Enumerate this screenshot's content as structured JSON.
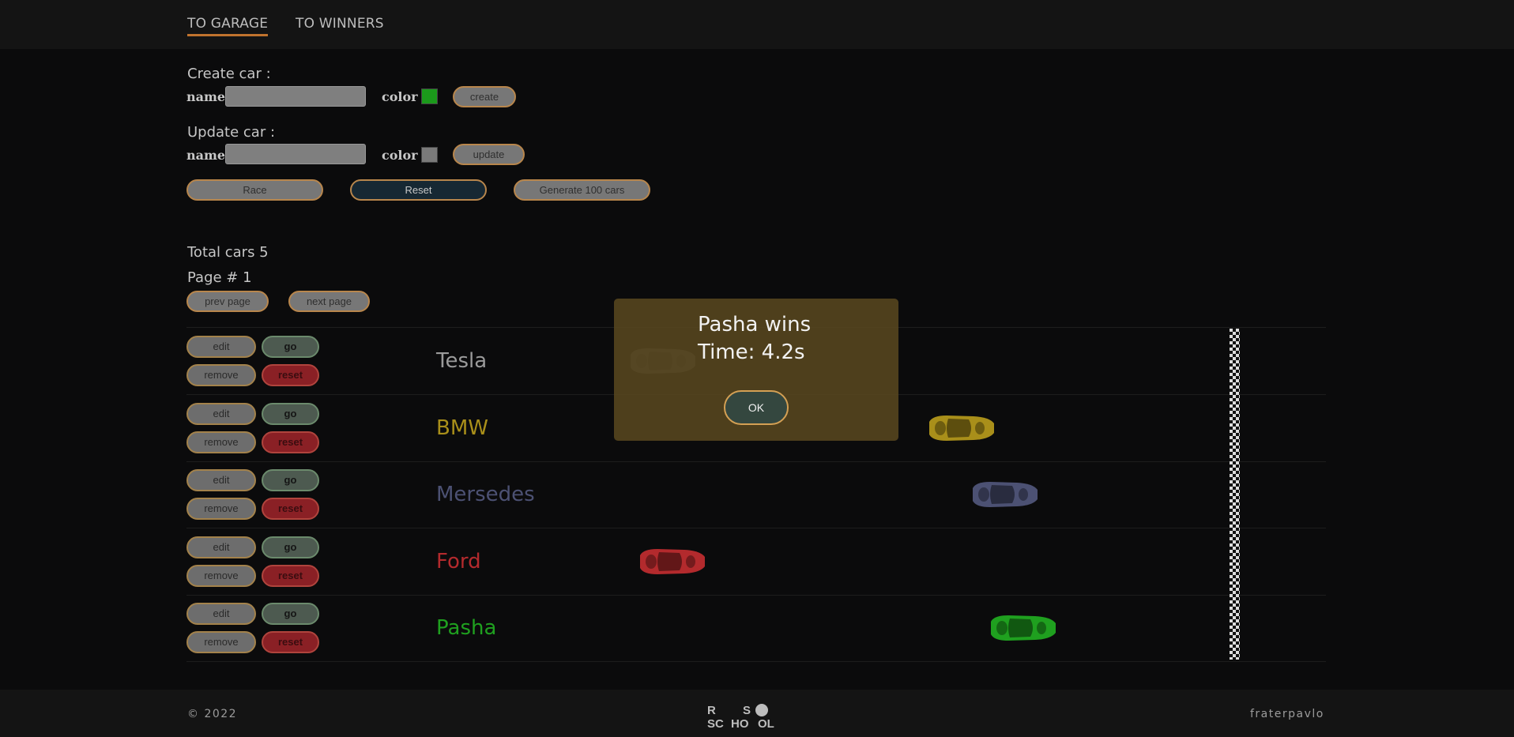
{
  "nav": {
    "garage_label": "TO GARAGE",
    "winners_label": "TO WINNERS"
  },
  "create": {
    "title": "Create car :",
    "name_label": "name",
    "name_value": "",
    "color_label": "color",
    "color_value": "#1b9a1b",
    "button_label": "create"
  },
  "update": {
    "title": "Update car :",
    "name_label": "name",
    "name_value": "",
    "color_label": "color",
    "color_value": "#7a7a7a",
    "button_label": "update"
  },
  "actions": {
    "race_label": "Race",
    "reset_label": "Reset",
    "generate_label": "Generate 100 cars"
  },
  "garage": {
    "total_text": "Total cars 5",
    "page_text": "Page # 1",
    "prev_label": "prev page",
    "next_label": "next page"
  },
  "controls": {
    "edit_label": "edit",
    "go_label": "go",
    "remove_label": "remove",
    "reset_label": "reset"
  },
  "cars": [
    {
      "name": "Tesla",
      "color": "#9b9b9b",
      "progress": 0.24,
      "opacity": 0.35
    },
    {
      "name": "BMW",
      "color": "#a98f1a",
      "progress": 0.58,
      "opacity": 1
    },
    {
      "name": "Mersedes",
      "color": "#4c5173",
      "progress": 0.63,
      "opacity": 1
    },
    {
      "name": "Ford",
      "color": "#b32a2d",
      "progress": 0.25,
      "opacity": 1
    },
    {
      "name": "Pasha",
      "color": "#1fa01f",
      "progress": 0.65,
      "opacity": 1
    }
  ],
  "modal": {
    "winner_text": "Pasha wins",
    "time_text": "Time: 4.2s",
    "ok_label": "OK"
  },
  "footer": {
    "copyright": "© 2022",
    "logo_text": "RS SCHOOL",
    "author": "fraterpavlo"
  }
}
